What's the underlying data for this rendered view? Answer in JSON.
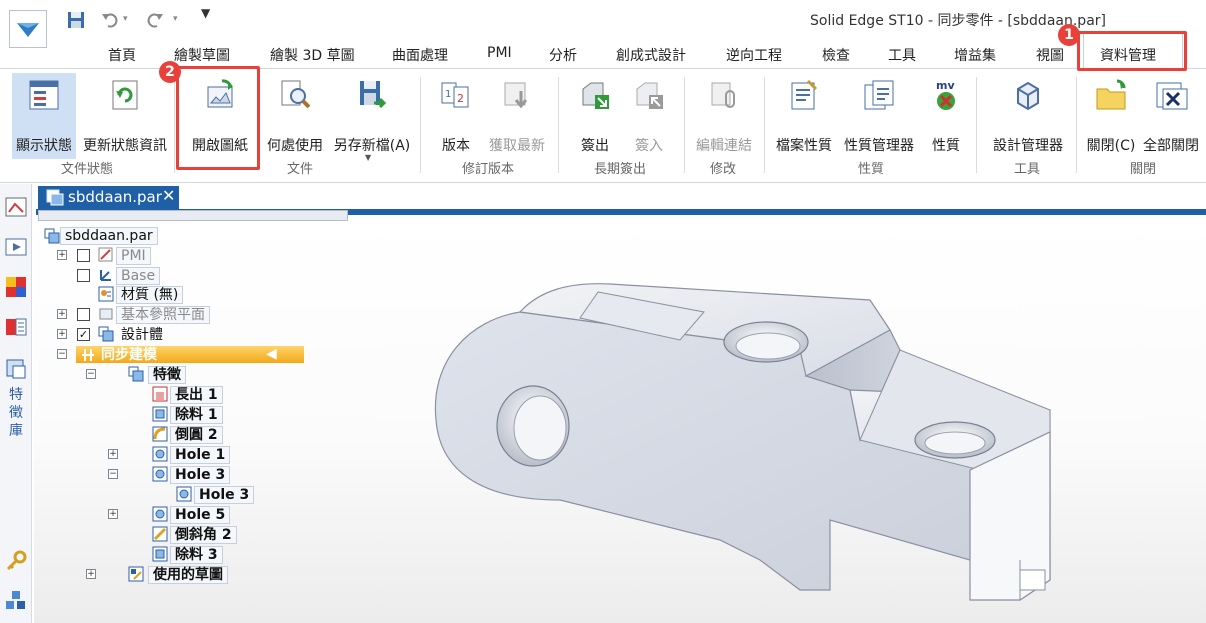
{
  "window": {
    "title": "Solid Edge ST10 - 同步零件 - [sbddaan.par]"
  },
  "tabs": [
    {
      "label": "首頁"
    },
    {
      "label": "繪製草圖"
    },
    {
      "label": "繪製 3D 草圖"
    },
    {
      "label": "曲面處理"
    },
    {
      "label": "PMI"
    },
    {
      "label": "分析"
    },
    {
      "label": "創成式設計"
    },
    {
      "label": "逆向工程"
    },
    {
      "label": "檢查"
    },
    {
      "label": "工具"
    },
    {
      "label": "增益集"
    },
    {
      "label": "視圖"
    },
    {
      "label": "資料管理"
    }
  ],
  "ribbon": {
    "buttons": [
      {
        "label": "顯示狀態",
        "icon": "display-status-icon"
      },
      {
        "label": "更新狀態資訊",
        "icon": "refresh-status-icon"
      },
      {
        "label": "開啟圖紙",
        "icon": "open-drawing-icon"
      },
      {
        "label": "何處使用",
        "icon": "where-used-icon"
      },
      {
        "label": "另存新檔(A)",
        "icon": "save-as-icon"
      },
      {
        "label": "版本",
        "icon": "revision-icon"
      },
      {
        "label": "獲取最新",
        "icon": "get-latest-icon"
      },
      {
        "label": "簽出",
        "icon": "check-out-icon"
      },
      {
        "label": "簽入",
        "icon": "check-in-icon"
      },
      {
        "label": "編輯連結",
        "icon": "edit-links-icon"
      },
      {
        "label": "檔案性質",
        "icon": "file-properties-icon"
      },
      {
        "label": "性質管理器",
        "icon": "property-manager-icon"
      },
      {
        "label": "性質",
        "icon": "properties-icon"
      },
      {
        "label": "設計管理器",
        "icon": "design-manager-icon"
      },
      {
        "label": "關閉(C)",
        "icon": "close-folder-icon"
      },
      {
        "label": "全部關閉",
        "icon": "close-all-icon"
      }
    ],
    "groups": [
      {
        "label": "文件狀態"
      },
      {
        "label": "文件"
      },
      {
        "label": "修訂版本"
      },
      {
        "label": "長期簽出"
      },
      {
        "label": "修改"
      },
      {
        "label": "性質"
      },
      {
        "label": "工具"
      },
      {
        "label": "關閉"
      }
    ]
  },
  "callouts": [
    {
      "number": "1"
    },
    {
      "number": "2"
    }
  ],
  "document_tab": {
    "label": "sbddaan.par"
  },
  "leftbar": {
    "vertical_label": "特徵庫"
  },
  "tree": [
    {
      "label": "sbddaan.par"
    },
    {
      "label": "PMI"
    },
    {
      "label": "Base"
    },
    {
      "label": "材質 (無)"
    },
    {
      "label": "基本參照平面"
    },
    {
      "label": "設計體"
    },
    {
      "label": "同步建模"
    },
    {
      "label": "特徵"
    },
    {
      "label": "長出 1"
    },
    {
      "label": "除料 1"
    },
    {
      "label": "倒圓 2"
    },
    {
      "label": "Hole 1"
    },
    {
      "label": "Hole 3"
    },
    {
      "label": "Hole 3"
    },
    {
      "label": "Hole 5"
    },
    {
      "label": "倒斜角 2"
    },
    {
      "label": "除料 3"
    },
    {
      "label": "使用的草圖"
    }
  ]
}
